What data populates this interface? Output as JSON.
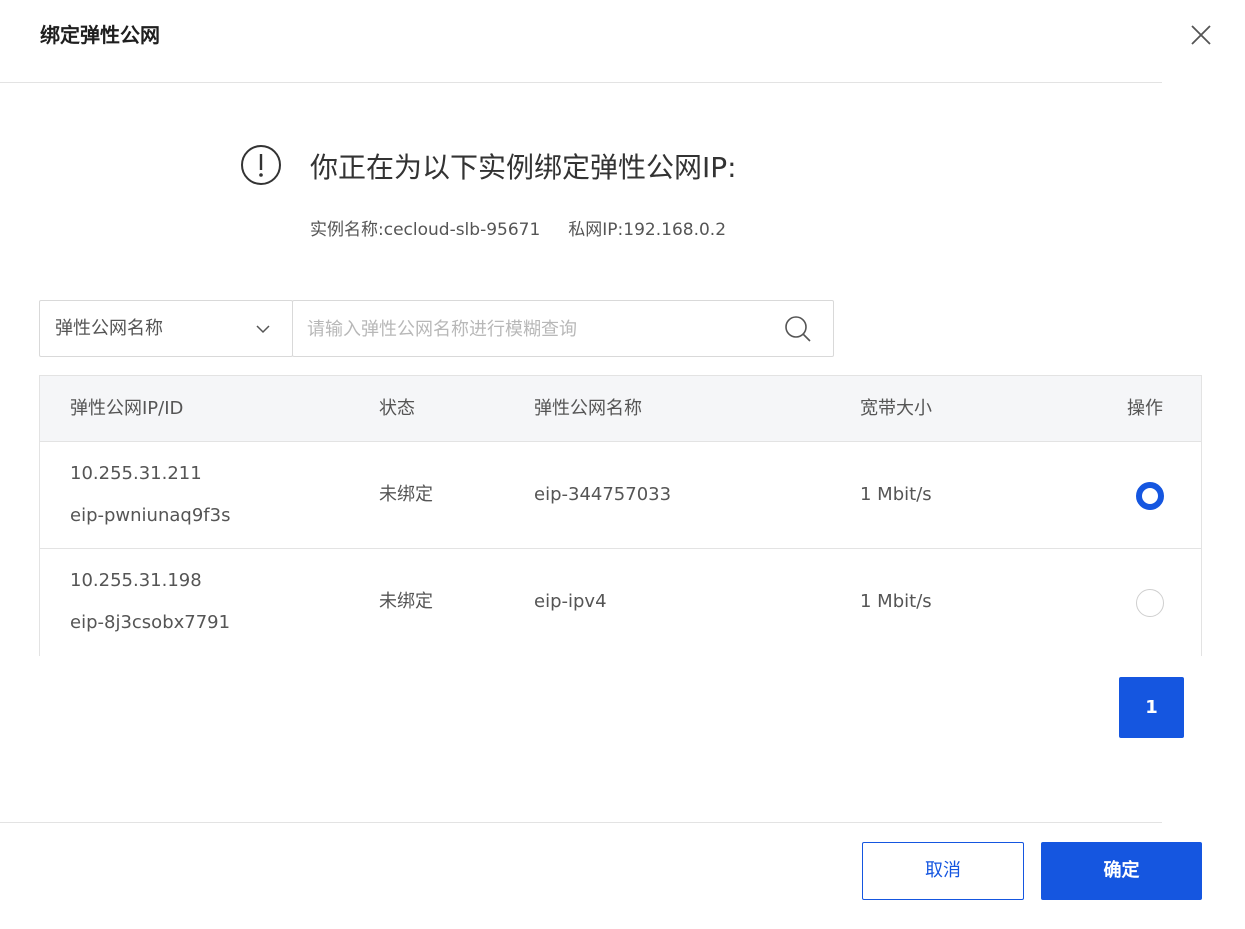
{
  "dialog": {
    "title": "绑定弹性公网",
    "close_icon": "close-icon"
  },
  "notice": {
    "icon": "exclamation-circle-icon",
    "title": "你正在为以下实例绑定弹性公网IP:",
    "instance_name": "实例名称:cecloud-slb-95671",
    "private_ip": "私网IP:192.168.0.2"
  },
  "filter": {
    "select_value": "弹性公网名称",
    "chevron_icon": "chevron-down-icon",
    "search_placeholder": "请输入弹性公网名称进行模糊查询",
    "search_value": "",
    "search_icon": "search-icon"
  },
  "table": {
    "headers": [
      "弹性公网IP/ID",
      "状态",
      "弹性公网名称",
      "宽带大小",
      "操作"
    ],
    "rows": [
      {
        "ip": "10.255.31.211",
        "id": "eip-pwniunaq9f3s",
        "status": "未绑定",
        "name": "eip-344757033",
        "bandwidth": "1 Mbit/s",
        "selected": true
      },
      {
        "ip": "10.255.31.198",
        "id": "eip-8j3csobx7791",
        "status": "未绑定",
        "name": "eip-ipv4",
        "bandwidth": "1 Mbit/s",
        "selected": false
      }
    ]
  },
  "pagination": {
    "current_page": "1"
  },
  "footer": {
    "cancel_label": "取消",
    "ok_label": "确定"
  },
  "colors": {
    "primary": "#1556e0",
    "border": "#e3e3e3",
    "header_bg": "#f5f6f8"
  }
}
